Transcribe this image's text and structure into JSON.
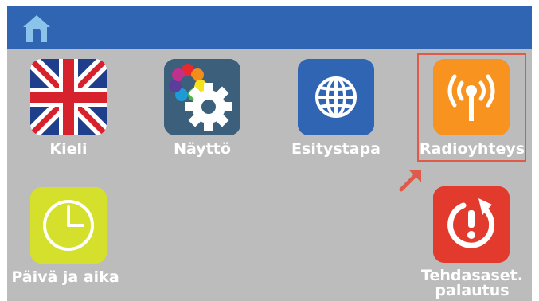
{
  "header": {
    "home_icon": "home-icon",
    "color": "#2f65b2"
  },
  "tiles": [
    {
      "id": "kieli",
      "label": "Kieli",
      "icon": "uk-flag-icon"
    },
    {
      "id": "naytto",
      "label": "Näyttö",
      "icon": "display-settings-gear-icon"
    },
    {
      "id": "esitystapa",
      "label": "Esitystapa",
      "icon": "globe-icon"
    },
    {
      "id": "radioyhteys",
      "label": "Radioyhteys",
      "icon": "radio-antenna-icon",
      "selected": true
    },
    {
      "id": "paiva-ja-aika",
      "label": "Päivä ja aika",
      "icon": "clock-icon"
    },
    {
      "id": "tehdasasetukset",
      "label_line1": "Tehdasaset.",
      "label_line2": "palautus",
      "icon": "factory-reset-icon"
    }
  ],
  "colors": {
    "background": "#bcbcbc",
    "radio_tile": "#f7931e",
    "globe_tile": "#2f65b2",
    "clock_tile": "#d4e02b",
    "reset_tile": "#e23b2e",
    "display_tile": "#3c5f7b",
    "selection": "#e05a4a"
  }
}
